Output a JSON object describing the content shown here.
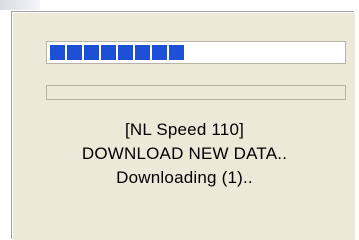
{
  "dialog": {
    "progress_primary": {
      "value_fraction": 0.47
    },
    "progress_secondary": {
      "value_fraction": 0.0
    },
    "status_lines": [
      "[NL Speed 110]",
      "DOWNLOAD NEW DATA..",
      "Downloading (1).."
    ],
    "colors": {
      "dialog_bg": "#ece9d8",
      "progress_fill": "#1f4fd7"
    }
  }
}
